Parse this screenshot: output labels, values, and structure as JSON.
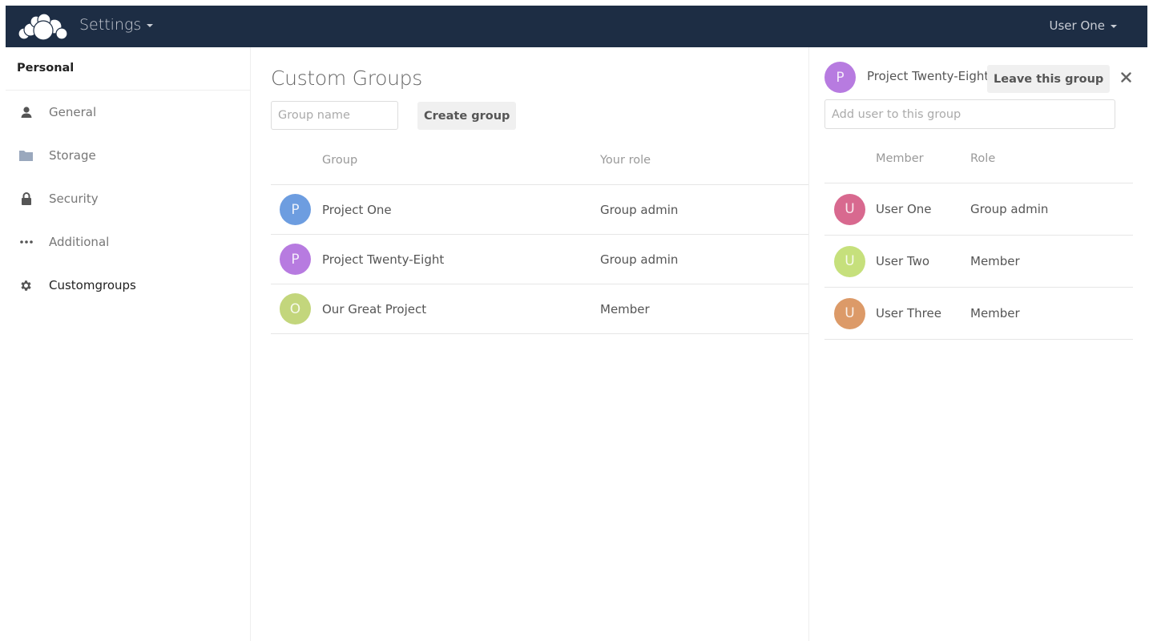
{
  "header": {
    "app_title": "Settings",
    "user_name": "User One"
  },
  "sidebar": {
    "section": "Personal",
    "items": [
      {
        "label": "General",
        "icon": "user-icon",
        "active": false
      },
      {
        "label": "Storage",
        "icon": "folder-icon",
        "active": false
      },
      {
        "label": "Security",
        "icon": "lock-icon",
        "active": false
      },
      {
        "label": "Additional",
        "icon": "more-icon",
        "active": false
      },
      {
        "label": "Customgroups",
        "icon": "gear-icon",
        "active": true
      }
    ]
  },
  "main": {
    "title": "Custom Groups",
    "group_name_placeholder": "Group name",
    "create_button": "Create group",
    "columns": {
      "group": "Group",
      "role": "Your role"
    },
    "groups": [
      {
        "initial": "P",
        "name": "Project One",
        "role": "Group admin",
        "color": "#6d9de0"
      },
      {
        "initial": "P",
        "name": "Project Twenty-Eight",
        "role": "Group admin",
        "color": "#b77be0"
      },
      {
        "initial": "O",
        "name": "Our Great Project",
        "role": "Member",
        "color": "#c3d67c"
      }
    ]
  },
  "panel": {
    "initial": "P",
    "color": "#b77be0",
    "title": "Project Twenty-Eight",
    "leave_button": "Leave this group",
    "add_user_placeholder": "Add user to this group",
    "columns": {
      "member": "Member",
      "role": "Role"
    },
    "members": [
      {
        "initial": "U",
        "name": "User One",
        "role": "Group admin",
        "color": "#d8698f"
      },
      {
        "initial": "U",
        "name": "User Two",
        "role": "Member",
        "color": "#c6e07c"
      },
      {
        "initial": "U",
        "name": "User Three",
        "role": "Member",
        "color": "#dc9a68"
      }
    ]
  }
}
